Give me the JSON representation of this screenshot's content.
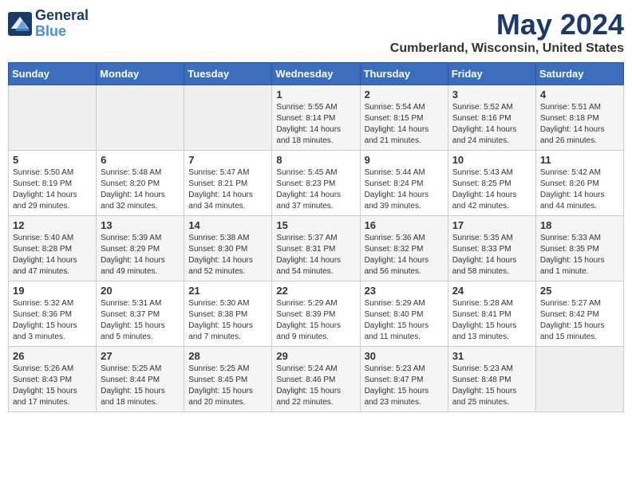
{
  "header": {
    "logo_line1": "General",
    "logo_line2": "Blue",
    "month_title": "May 2024",
    "location": "Cumberland, Wisconsin, United States"
  },
  "weekdays": [
    "Sunday",
    "Monday",
    "Tuesday",
    "Wednesday",
    "Thursday",
    "Friday",
    "Saturday"
  ],
  "weeks": [
    [
      {
        "day": "",
        "info": ""
      },
      {
        "day": "",
        "info": ""
      },
      {
        "day": "",
        "info": ""
      },
      {
        "day": "1",
        "info": "Sunrise: 5:55 AM\nSunset: 8:14 PM\nDaylight: 14 hours\nand 18 minutes."
      },
      {
        "day": "2",
        "info": "Sunrise: 5:54 AM\nSunset: 8:15 PM\nDaylight: 14 hours\nand 21 minutes."
      },
      {
        "day": "3",
        "info": "Sunrise: 5:52 AM\nSunset: 8:16 PM\nDaylight: 14 hours\nand 24 minutes."
      },
      {
        "day": "4",
        "info": "Sunrise: 5:51 AM\nSunset: 8:18 PM\nDaylight: 14 hours\nand 26 minutes."
      }
    ],
    [
      {
        "day": "5",
        "info": "Sunrise: 5:50 AM\nSunset: 8:19 PM\nDaylight: 14 hours\nand 29 minutes."
      },
      {
        "day": "6",
        "info": "Sunrise: 5:48 AM\nSunset: 8:20 PM\nDaylight: 14 hours\nand 32 minutes."
      },
      {
        "day": "7",
        "info": "Sunrise: 5:47 AM\nSunset: 8:21 PM\nDaylight: 14 hours\nand 34 minutes."
      },
      {
        "day": "8",
        "info": "Sunrise: 5:45 AM\nSunset: 8:23 PM\nDaylight: 14 hours\nand 37 minutes."
      },
      {
        "day": "9",
        "info": "Sunrise: 5:44 AM\nSunset: 8:24 PM\nDaylight: 14 hours\nand 39 minutes."
      },
      {
        "day": "10",
        "info": "Sunrise: 5:43 AM\nSunset: 8:25 PM\nDaylight: 14 hours\nand 42 minutes."
      },
      {
        "day": "11",
        "info": "Sunrise: 5:42 AM\nSunset: 8:26 PM\nDaylight: 14 hours\nand 44 minutes."
      }
    ],
    [
      {
        "day": "12",
        "info": "Sunrise: 5:40 AM\nSunset: 8:28 PM\nDaylight: 14 hours\nand 47 minutes."
      },
      {
        "day": "13",
        "info": "Sunrise: 5:39 AM\nSunset: 8:29 PM\nDaylight: 14 hours\nand 49 minutes."
      },
      {
        "day": "14",
        "info": "Sunrise: 5:38 AM\nSunset: 8:30 PM\nDaylight: 14 hours\nand 52 minutes."
      },
      {
        "day": "15",
        "info": "Sunrise: 5:37 AM\nSunset: 8:31 PM\nDaylight: 14 hours\nand 54 minutes."
      },
      {
        "day": "16",
        "info": "Sunrise: 5:36 AM\nSunset: 8:32 PM\nDaylight: 14 hours\nand 56 minutes."
      },
      {
        "day": "17",
        "info": "Sunrise: 5:35 AM\nSunset: 8:33 PM\nDaylight: 14 hours\nand 58 minutes."
      },
      {
        "day": "18",
        "info": "Sunrise: 5:33 AM\nSunset: 8:35 PM\nDaylight: 15 hours\nand 1 minute."
      }
    ],
    [
      {
        "day": "19",
        "info": "Sunrise: 5:32 AM\nSunset: 8:36 PM\nDaylight: 15 hours\nand 3 minutes."
      },
      {
        "day": "20",
        "info": "Sunrise: 5:31 AM\nSunset: 8:37 PM\nDaylight: 15 hours\nand 5 minutes."
      },
      {
        "day": "21",
        "info": "Sunrise: 5:30 AM\nSunset: 8:38 PM\nDaylight: 15 hours\nand 7 minutes."
      },
      {
        "day": "22",
        "info": "Sunrise: 5:29 AM\nSunset: 8:39 PM\nDaylight: 15 hours\nand 9 minutes."
      },
      {
        "day": "23",
        "info": "Sunrise: 5:29 AM\nSunset: 8:40 PM\nDaylight: 15 hours\nand 11 minutes."
      },
      {
        "day": "24",
        "info": "Sunrise: 5:28 AM\nSunset: 8:41 PM\nDaylight: 15 hours\nand 13 minutes."
      },
      {
        "day": "25",
        "info": "Sunrise: 5:27 AM\nSunset: 8:42 PM\nDaylight: 15 hours\nand 15 minutes."
      }
    ],
    [
      {
        "day": "26",
        "info": "Sunrise: 5:26 AM\nSunset: 8:43 PM\nDaylight: 15 hours\nand 17 minutes."
      },
      {
        "day": "27",
        "info": "Sunrise: 5:25 AM\nSunset: 8:44 PM\nDaylight: 15 hours\nand 18 minutes."
      },
      {
        "day": "28",
        "info": "Sunrise: 5:25 AM\nSunset: 8:45 PM\nDaylight: 15 hours\nand 20 minutes."
      },
      {
        "day": "29",
        "info": "Sunrise: 5:24 AM\nSunset: 8:46 PM\nDaylight: 15 hours\nand 22 minutes."
      },
      {
        "day": "30",
        "info": "Sunrise: 5:23 AM\nSunset: 8:47 PM\nDaylight: 15 hours\nand 23 minutes."
      },
      {
        "day": "31",
        "info": "Sunrise: 5:23 AM\nSunset: 8:48 PM\nDaylight: 15 hours\nand 25 minutes."
      },
      {
        "day": "",
        "info": ""
      }
    ]
  ]
}
